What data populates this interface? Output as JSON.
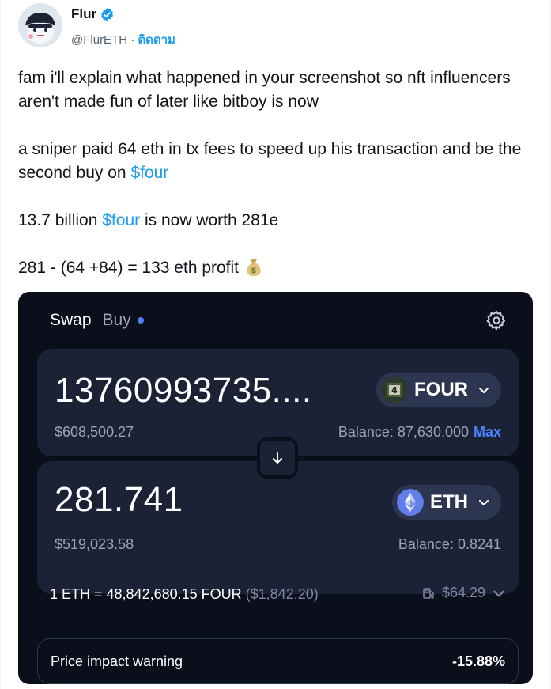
{
  "author": {
    "display_name": "Flur",
    "handle": "@FlurETH",
    "separator": "·",
    "follow_label": "ติดตาม",
    "verified": true,
    "accent": "#1d9bf0"
  },
  "tweet": {
    "line1": "fam i'll explain what happened in your screenshot so nft influencers aren't made fun of later like bitboy is now",
    "line2_before": "a sniper paid 64 eth in tx fees to speed up his transaction and be the second buy on ",
    "line2_cashtag": "$four",
    "line3_before": "13.7 billion ",
    "line3_cashtag": "$four",
    "line3_after": " is now worth 281e",
    "line4": "281 - (64 +84) = 133 eth profit ",
    "line4_emoji": "money-bag-icon"
  },
  "swap_widget": {
    "tabs": [
      "Swap",
      "Buy"
    ],
    "from": {
      "amount": "13760993735....",
      "usd": "$608,500.27",
      "balance": "Balance: 87,630,000",
      "max_label": "Max",
      "token": "FOUR"
    },
    "to": {
      "amount": "281.741",
      "usd": "$519,023.58",
      "balance": "Balance: 0.8241",
      "token": "ETH"
    },
    "rate": {
      "text": "1 ETH = 48,842,680.15 FOUR",
      "usd": "($1,842.20)",
      "gas": "$64.29"
    },
    "warning": {
      "label": "Price impact warning",
      "value": "-15.88%"
    },
    "colors": {
      "background": "#0b0f1c",
      "panel": "#1b2236",
      "accent": "#4c82fb"
    }
  }
}
